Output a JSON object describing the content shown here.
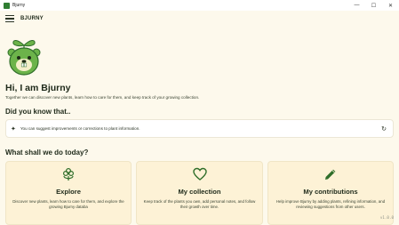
{
  "window": {
    "title": "Bjurny",
    "controls": {
      "minimize": "—",
      "maximize": "☐",
      "close": "✕"
    }
  },
  "appbar": {
    "app_name": "BJURNY"
  },
  "hero": {
    "greeting": "Hi, I am Bjurny",
    "tagline": "Together we can discover new plants, learn how to care for them, and keep track of your growing collection."
  },
  "fact": {
    "heading": "Did you know that..",
    "text": "You can suggest improvements or corrections to plant information."
  },
  "actions": {
    "heading": "What shall we do today?",
    "cards": [
      {
        "title": "Explore",
        "description": "Discover new plants, learn how to care for them, and explore the growing Bjurny databa"
      },
      {
        "title": "My collection",
        "description": "Keep track of the plants you own, add personal notes, and follow their growth over time."
      },
      {
        "title": "My contributions",
        "description": "Help improve Bjurny by adding plants, refining information, and reviewing suggestions from other users."
      }
    ]
  },
  "version": "v1.0.0",
  "colors": {
    "brand_green": "#6cb34a",
    "dark_green": "#2f6e2a",
    "card_bg": "#fdf2d6",
    "page_bg": "#fdf9ec"
  }
}
